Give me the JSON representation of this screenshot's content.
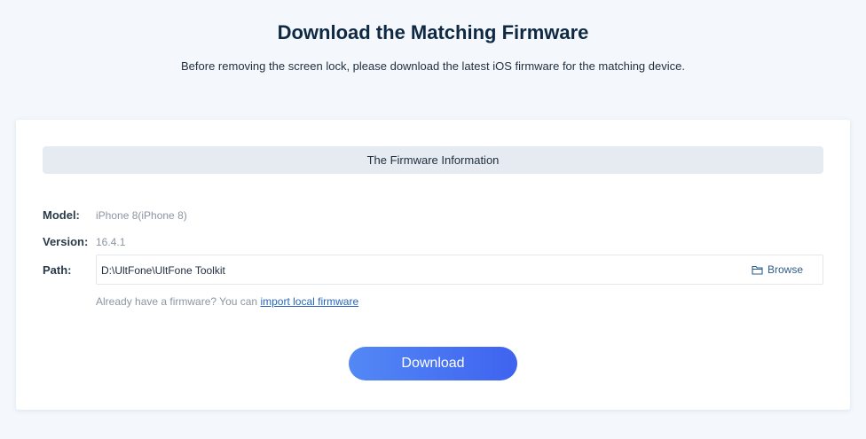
{
  "header": {
    "title": "Download the Matching Firmware",
    "subtitle": "Before removing the screen lock, please download the latest iOS firmware for the matching device."
  },
  "firmware_card": {
    "section_title": "The Firmware Information",
    "model_label": "Model:",
    "model_value": "iPhone 8(iPhone 8)",
    "version_label": "Version:",
    "version_value": "16.4.1",
    "path_label": "Path:",
    "path_value": "D:\\UltFone\\UltFone Toolkit",
    "browse_label": "Browse",
    "browse_icon": "folder-icon",
    "hint_text": "Already have a firmware? You can ",
    "import_link_label": "import local firmware",
    "download_label": "Download"
  },
  "colors": {
    "accent": "#4a74f3",
    "link": "#2a66b8",
    "background": "#f4f8fd"
  }
}
